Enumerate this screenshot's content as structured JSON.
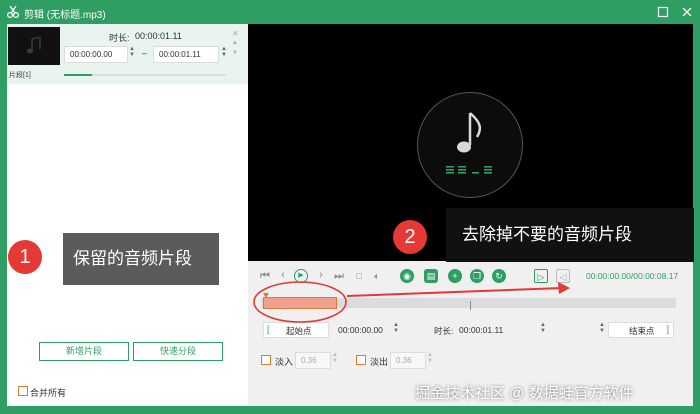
{
  "window": {
    "title": "剪辑 (无标题.mp3)"
  },
  "segment_editor": {
    "duration_label": "时长:",
    "duration_value": "00:00:01.11",
    "start_time": "00:00:00.00",
    "separator": "–",
    "end_time": "00:00:01.11",
    "segment_label": "片段[1]",
    "segment_progress": 0.17
  },
  "left_buttons": {
    "add_segment": "新增片段",
    "quick_split": "快速分段",
    "merge_all": "合并所有"
  },
  "player": {
    "time_display": "00:00:00.00/00:00:08.17",
    "position_current": "00:00:00.00",
    "position_total": "00:00:08.17"
  },
  "trim": {
    "start_point_label": "起始点",
    "start_value": "00:00:00.00",
    "duration_label": "时长:",
    "duration_value": "00:00:01.11",
    "end_point_label": "结束点",
    "fade_in_label": "淡入",
    "fade_in_value": "0.36",
    "fade_out_label": "淡出",
    "fade_out_value": "0.36",
    "selected_fraction": 0.09
  },
  "annotations": {
    "badge_1": "1",
    "callout_1": "保留的音频片段",
    "badge_2": "2",
    "callout_2": "去除掉不要的音频片段"
  },
  "watermark": "掘金技术社区 @ 数据蛙官方软件",
  "colors": {
    "brand_green": "#2f9e62",
    "callout_bg": "#5b5b5b",
    "badge_red": "#e53935",
    "selection_fill": "#f0a090",
    "orange_accent": "#e07a2e"
  }
}
